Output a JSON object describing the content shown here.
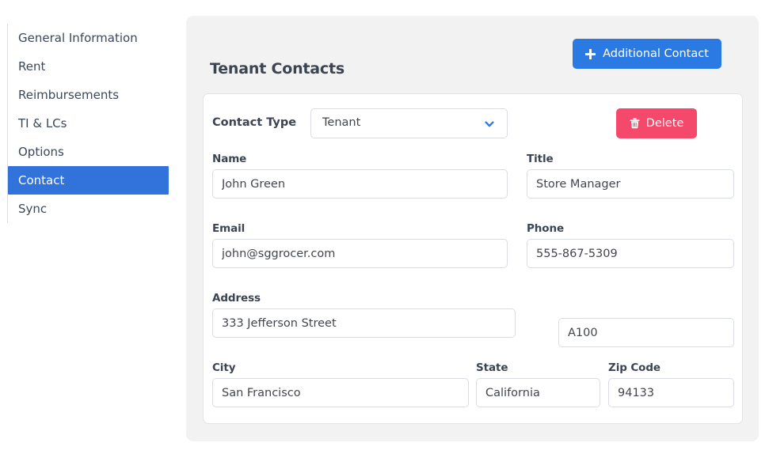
{
  "sidebar": {
    "items": [
      {
        "label": "General Information",
        "active": false
      },
      {
        "label": "Rent",
        "active": false
      },
      {
        "label": "Reimbursements",
        "active": false
      },
      {
        "label": "TI & LCs",
        "active": false
      },
      {
        "label": "Options",
        "active": false
      },
      {
        "label": "Contact",
        "active": true
      },
      {
        "label": "Sync",
        "active": false
      }
    ]
  },
  "header": {
    "title": "Tenant Contacts",
    "add_button_label": "Additional Contact",
    "add_button_icon": "plus-icon",
    "accent_color": "#2b7ae4"
  },
  "contact_card": {
    "type_label": "Contact Type",
    "type_value": "Tenant",
    "type_options": [
      "Tenant"
    ],
    "chevron_icon": "chevron-down-icon",
    "delete_button_label": "Delete",
    "delete_button_icon": "trash-icon",
    "delete_color": "#f4496a",
    "fields": {
      "name": {
        "label": "Name",
        "value": "John Green"
      },
      "title": {
        "label": "Title",
        "value": "Store Manager"
      },
      "email": {
        "label": "Email",
        "value": "john@sggrocer.com"
      },
      "phone": {
        "label": "Phone",
        "value": "555-867-5309"
      },
      "address": {
        "label": "Address",
        "value": "333 Jefferson Street"
      },
      "unit": {
        "label": "",
        "value": "A100"
      },
      "city": {
        "label": "City",
        "value": "San Francisco"
      },
      "state": {
        "label": "State",
        "value": "California"
      },
      "zip": {
        "label": "Zip Code",
        "value": "94133"
      }
    }
  }
}
